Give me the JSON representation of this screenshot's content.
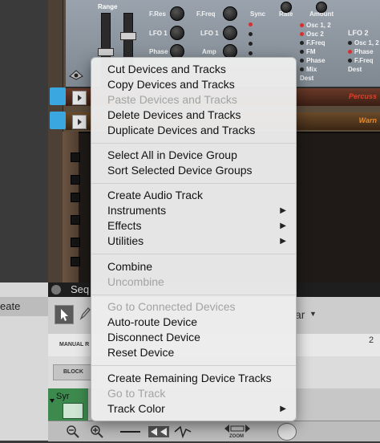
{
  "synth": {
    "range_label": "Range",
    "f_res": "F.Res",
    "f_freq": "F.Freq",
    "lfo1": "LFO 1",
    "phase": "Phase",
    "amp": "Amp",
    "sync": "Sync",
    "rate": "Rate",
    "amount": "Amount",
    "dest_list": [
      "Osc 1, 2",
      "Osc 2",
      "F.Freq",
      "FM",
      "Phase",
      "Mix"
    ],
    "dest_label": "Dest",
    "lfo2_title": "LFO 2",
    "lfo2_list": [
      "Osc 1, 2",
      "Phase",
      "F.Freq",
      "Dest"
    ]
  },
  "rack": {
    "strip1_label": "Percuss",
    "strip2_label": "Warn"
  },
  "sequencer": {
    "title": "Seq",
    "create_label": "eate",
    "manual_label": "MANUAL R",
    "block_label": "BLOCK",
    "track_name": "Syr",
    "ruler_mark": "2",
    "zoom_label": "ZOOM",
    "snap_label": "ar"
  },
  "context_menu": {
    "groups": [
      [
        {
          "label": "Cut Devices and Tracks",
          "enabled": true
        },
        {
          "label": "Copy Devices and Tracks",
          "enabled": true
        },
        {
          "label": "Paste Devices and Tracks",
          "enabled": false
        },
        {
          "label": "Delete Devices and Tracks",
          "enabled": true
        },
        {
          "label": "Duplicate Devices and Tracks",
          "enabled": true
        }
      ],
      [
        {
          "label": "Select All in Device Group",
          "enabled": true
        },
        {
          "label": "Sort Selected Device Groups",
          "enabled": true
        }
      ],
      [
        {
          "label": "Create Audio Track",
          "enabled": true
        },
        {
          "label": "Instruments",
          "enabled": true,
          "submenu": true
        },
        {
          "label": "Effects",
          "enabled": true,
          "submenu": true
        },
        {
          "label": "Utilities",
          "enabled": true,
          "submenu": true
        }
      ],
      [
        {
          "label": "Combine",
          "enabled": true
        },
        {
          "label": "Uncombine",
          "enabled": false
        }
      ],
      [
        {
          "label": "Go to Connected Devices",
          "enabled": false
        },
        {
          "label": "Auto-route Device",
          "enabled": true
        },
        {
          "label": "Disconnect Device",
          "enabled": true
        },
        {
          "label": "Reset Device",
          "enabled": true
        }
      ],
      [
        {
          "label": "Create Remaining Device Tracks",
          "enabled": true
        },
        {
          "label": "Go to Track",
          "enabled": false
        },
        {
          "label": "Track Color",
          "enabled": true,
          "submenu": true
        }
      ]
    ],
    "submenu_arrow": "▶"
  },
  "colors": {
    "accent_blue": "#3aa7e0",
    "menu_bg": "#ececec",
    "disabled_text": "#a3a3a3",
    "strip1_text": "#e0402a",
    "strip2_text": "#e88a2a"
  }
}
